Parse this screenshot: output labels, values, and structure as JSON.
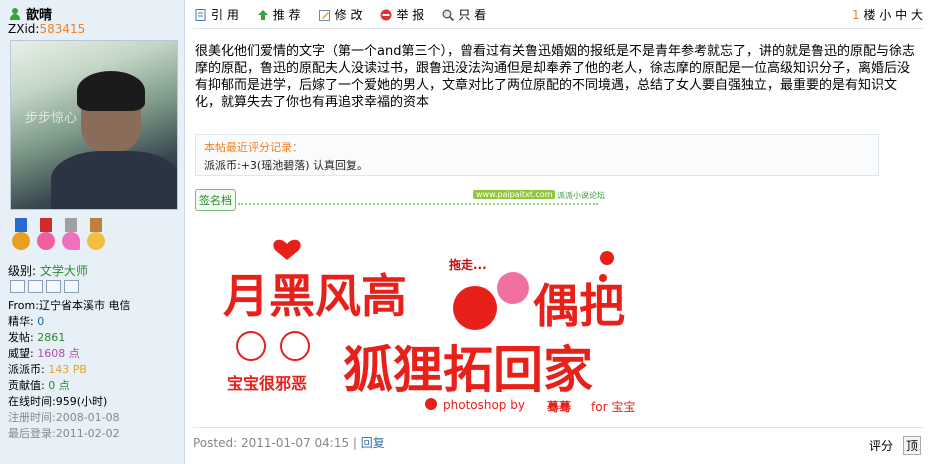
{
  "user": {
    "name": "歆晴",
    "zxid_label": "ZXid:",
    "zxid_value": "583415",
    "level_label": "级别:",
    "level_value": "文学大师",
    "from": "From:辽宁省本溪市  电信",
    "stats": [
      {
        "label": "精华:",
        "value": "0",
        "color": "#1a5fb4"
      },
      {
        "label": "发帖:",
        "value": "2861",
        "color": "#2a8a2a"
      },
      {
        "label": "威望:",
        "value": "1608 点",
        "color": "#b04aa8"
      },
      {
        "label": "派派币:",
        "value": "143 PB",
        "color": "#e8a020"
      },
      {
        "label": "贡献值:",
        "value": "0 点",
        "color": "#2a8a2a"
      }
    ],
    "online": "在线时间:959(小时)",
    "reg": "注册时间:2008-01-08",
    "last": "最后登录:2011-02-02",
    "avatar_caption": "步步惊心"
  },
  "toolbar": {
    "quote": "引 用",
    "recommend": "推 荐",
    "edit": "修 改",
    "report": "举 报",
    "only": "只 看"
  },
  "floor": {
    "num": "1",
    "unit": "楼",
    "small": "小",
    "mid": "中",
    "big": "大"
  },
  "post": {
    "text": "很美化他们爱情的文字（第一个and第三个），曾看过有关鲁迅婚姻的报纸是不是青年参考就忘了，讲的就是鲁迅的原配与徐志摩的原配，鲁迅的原配夫人没读过书，跟鲁迅没法沟通但是却奉养了他的老人，徐志摩的原配是一位高级知识分子，离婚后没有抑郁而是进学，后嫁了一个爱她的男人，文章对比了两位原配的不同境遇，总结了女人要自强独立，最重要的是有知识文化，就算失去了你也有再追求幸福的资本"
  },
  "rating": {
    "title": "本帖最近评分记录：",
    "line": "派派币:+3(瑶池碧落) 认真回复。"
  },
  "signature": {
    "btn": "签名档",
    "url": "www.paipaitxt.com",
    "site": "派派小说论坛",
    "banner_lines": [
      "月黑风高",
      "偶把",
      "狐狸拓回家",
      "宝宝很邪恶",
      "拖走...",
      "photoshop by",
      "蓦蓦",
      "for 宝宝"
    ]
  },
  "footer": {
    "posted": "Posted: 2011-01-07 04:15",
    "sep": " | ",
    "reply": "回复",
    "rate": "评分",
    "top": "顶"
  },
  "colors": {
    "accent": "#f08020",
    "banner_red": "#e8201a"
  }
}
